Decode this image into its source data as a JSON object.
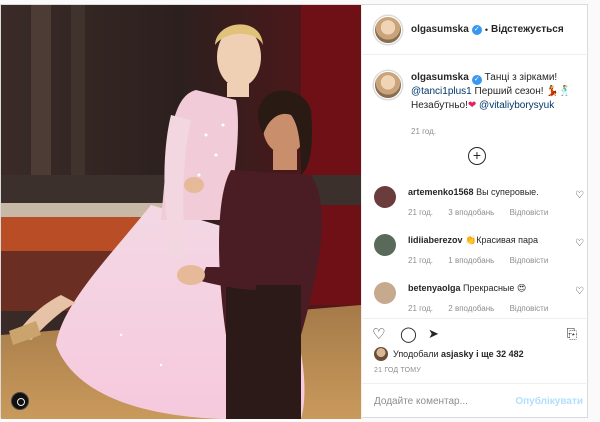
{
  "header": {
    "username": "olgasumska",
    "separator": "•",
    "follow_label": "Відстежується"
  },
  "caption": {
    "username": "olgasumska",
    "text_1": "Танці з зірками!",
    "mention_1": "@tanci1plus1",
    "text_2": "Перший сезон!",
    "emoji_dancers": "💃🕺",
    "text_3": "Незабутньо!",
    "emoji_heart": "❤",
    "mention_2": "@vitaliyborysyuk",
    "time": "21 год."
  },
  "comments": [
    {
      "username": "artemenko1568",
      "text": "Вы суперовые.",
      "time": "21 год.",
      "likes": "3 вподобань",
      "reply": "Відповісти",
      "avatar_color": "#6b3c3c"
    },
    {
      "username": "lidiiaberezov",
      "text": "Красивая пара",
      "emoji": "👏",
      "time": "21 год.",
      "likes": "1 вподобань",
      "reply": "Відповісти",
      "avatar_color": "#5a6a5a"
    },
    {
      "username": "betenyaolga",
      "text": "Прекрасные",
      "emoji": "😍",
      "time": "21 год.",
      "likes": "2 вподобань",
      "reply": "Відповісти",
      "avatar_color": "#c7a98e"
    }
  ],
  "likes": {
    "liked_by_prefix": "Уподобали",
    "liked_by_user": "asjasky",
    "and_more": "і ще 32 482"
  },
  "posted_ago": "21 ГОД ТОМУ",
  "add_comment": {
    "placeholder": "Додайте коментар...",
    "publish_label": "Опублікувати"
  },
  "icons": {
    "verified": "verified-badge-icon",
    "like": "heart-outline-icon",
    "comment": "comment-icon",
    "share": "paper-plane-icon",
    "save": "bookmark-icon",
    "add_comments": "plus-circle-icon"
  },
  "colors": {
    "verified_blue": "#3897f0",
    "link": "#00376b",
    "muted": "#8e8e8e",
    "publish_disabled": "#b2dffc"
  }
}
